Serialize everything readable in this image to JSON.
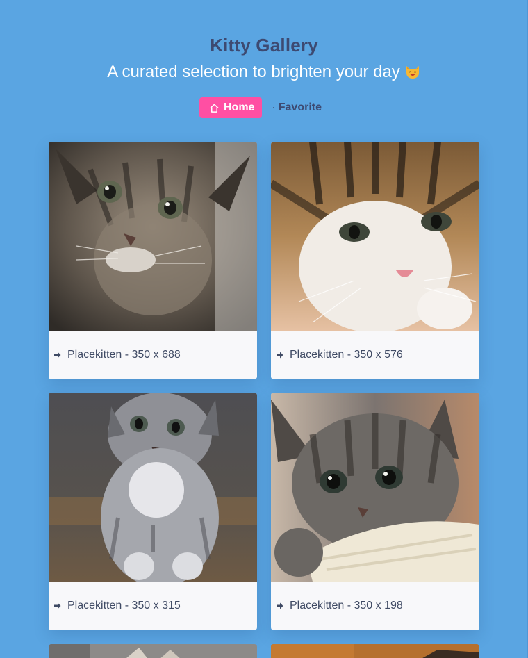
{
  "header": {
    "title": "Kitty Gallery",
    "subtitle": "A curated selection to brighten your day",
    "subtitle_emoji": "smiling-cat-face-icon"
  },
  "nav": {
    "home_label": "Home",
    "favorite_label": "Favorite"
  },
  "colors": {
    "background": "#5aa5e2",
    "accent": "#ff4fa3",
    "title": "#3d4a72",
    "card": "#f8f8fa"
  },
  "gallery": {
    "cards": [
      {
        "caption": "Placekitten - 350 x 688"
      },
      {
        "caption": "Placekitten - 350 x 576"
      },
      {
        "caption": "Placekitten - 350 x 315"
      },
      {
        "caption": "Placekitten - 350 x 198"
      }
    ]
  }
}
